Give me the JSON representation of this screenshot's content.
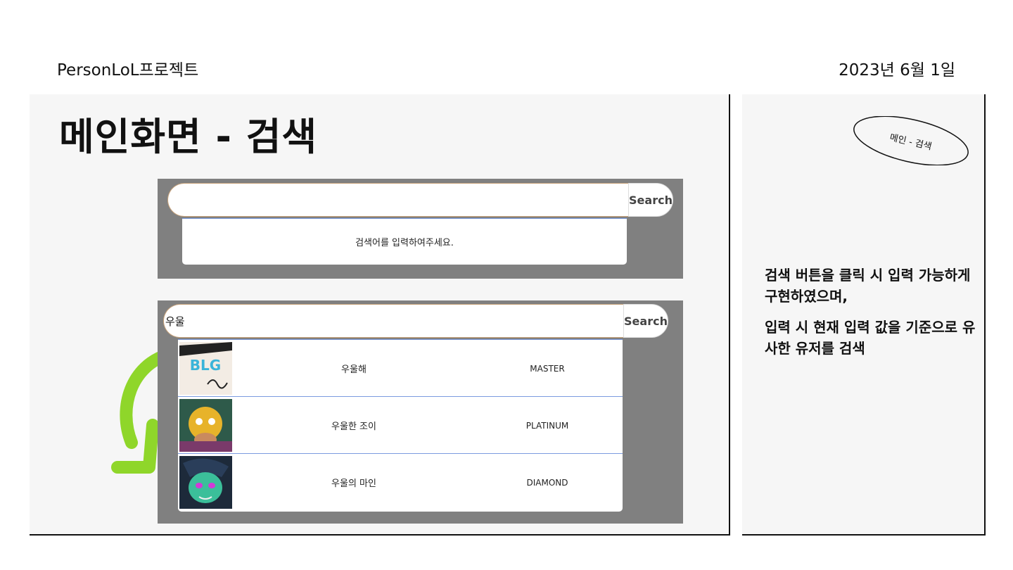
{
  "header": {
    "project": "PersonLoL프로젝트",
    "date": "2023년 6월 1일"
  },
  "main": {
    "title": "메인화면 - 검색",
    "empty_state": {
      "search_value": "",
      "search_button": "Search",
      "hint": "검색어를 입력하여주세요."
    },
    "results_state": {
      "search_value": "우울",
      "search_button": "Search",
      "results": [
        {
          "name": "우울해",
          "tier": "MASTER",
          "avatar_icon": "blg-logo-icon"
        },
        {
          "name": "우울한 조이",
          "tier": "PLATINUM",
          "avatar_icon": "yellow-yordle-icon"
        },
        {
          "name": "우울의 마인",
          "tier": "DIAMOND",
          "avatar_icon": "green-haired-champion-icon"
        }
      ]
    },
    "arrow_color": "#8fd62a"
  },
  "side": {
    "oval_label": "메인 - 검색",
    "description_1": "검색 버튼을 클릭 시 입력 가능하게 구현하였으며,",
    "description_2": "입력 시 현재 입력 값을 기준으로  유사한 유저를 검색"
  }
}
